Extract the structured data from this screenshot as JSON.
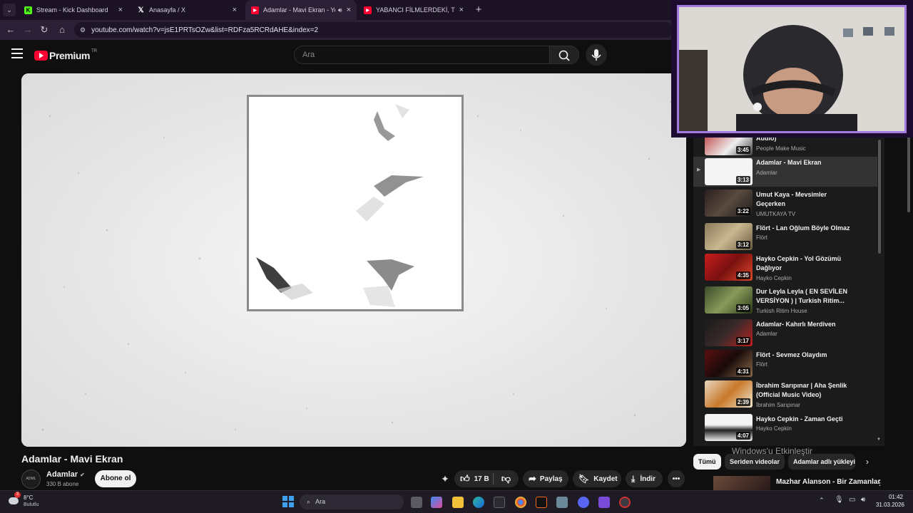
{
  "browser": {
    "tabs": [
      {
        "title": "Stream - Kick Dashboard",
        "icon": "kick-icon",
        "active": false
      },
      {
        "title": "Anasayfa / X",
        "icon": "x-logo-icon",
        "active": false
      },
      {
        "title": "Adamlar - Mavi Ekran - You",
        "icon": "youtube-icon",
        "active": true
      },
      {
        "title": "YABANCI FİLMLERDEKİ, TÜRKİYE",
        "icon": "youtube-icon",
        "active": false
      }
    ],
    "url": "youtube.com/watch?v=jsE1PRTsOZw&list=RDFza5RCRdAHE&index=2"
  },
  "youtube": {
    "logo_text": "Premium",
    "logo_region": "TR",
    "search_placeholder": "Ara"
  },
  "video": {
    "title": "Adamlar - Mavi Ekran",
    "channel": "Adamlar",
    "subscribers": "330 B abone",
    "subscribe_label": "Abone ol",
    "likes": "17 B",
    "share_label": "Paylaş",
    "save_label": "Kaydet",
    "download_label": "İndir"
  },
  "playlist": [
    {
      "title": "Audio)",
      "channel": "People Make Music",
      "duration": "3:45",
      "active": false
    },
    {
      "title": "Adamlar - Mavi Ekran",
      "channel": "Adamlar",
      "duration": "3:13",
      "active": true
    },
    {
      "title": "Umut Kaya - Mevsimler Geçerken",
      "channel": "UMUTKAYA TV",
      "duration": "3:22",
      "active": false
    },
    {
      "title": "Flört - Lan Oğlum Böyle Olmaz",
      "channel": "Flört",
      "duration": "3:12",
      "active": false
    },
    {
      "title": "Hayko Cepkin - Yol Gözümü Dağlıyor",
      "channel": "Hayko Cepkin",
      "duration": "4:35",
      "active": false
    },
    {
      "title": "Dur Leyla Leyla ( EN SEVİLEN VERSİYON ) | Turkish Ritim...",
      "channel": "Turkish Ritim House",
      "duration": "3:05",
      "active": false
    },
    {
      "title": "Adamlar- Kahırlı Merdiven",
      "channel": "Adamlar",
      "duration": "3:17",
      "active": false
    },
    {
      "title": "Flört - Sevmez Olaydım",
      "channel": "Flört",
      "duration": "4:31",
      "active": false
    },
    {
      "title": "İbrahim Sarıpınar | Aha Şenlik (Official Music Video)",
      "channel": "İbrahim Sarıpınar",
      "duration": "2:39",
      "active": false
    },
    {
      "title": "Hayko Cepkin - Zaman Geçti",
      "channel": "Hayko Cepkin",
      "duration": "4:07",
      "active": false
    }
  ],
  "chips": {
    "all": "Tümü",
    "series": "Seriden videolar",
    "uploads": "Adamlar adlı yükleyi"
  },
  "windows_activation": "Windows'u Etkinleştir",
  "next_video": "Mazhar Alanson - Bir Zamanlar",
  "taskbar": {
    "weather_temp": "8°C",
    "weather_desc": "Bulutlu",
    "search_placeholder": "Ara",
    "time": "01:42",
    "date": "31.03.2026",
    "weather_badge": "3"
  },
  "colors": {
    "tab_bg": "#1b1324",
    "tab_active": "#2c2036",
    "youtube_red": "#ff0033",
    "webcam_border": "#a27ae0"
  }
}
